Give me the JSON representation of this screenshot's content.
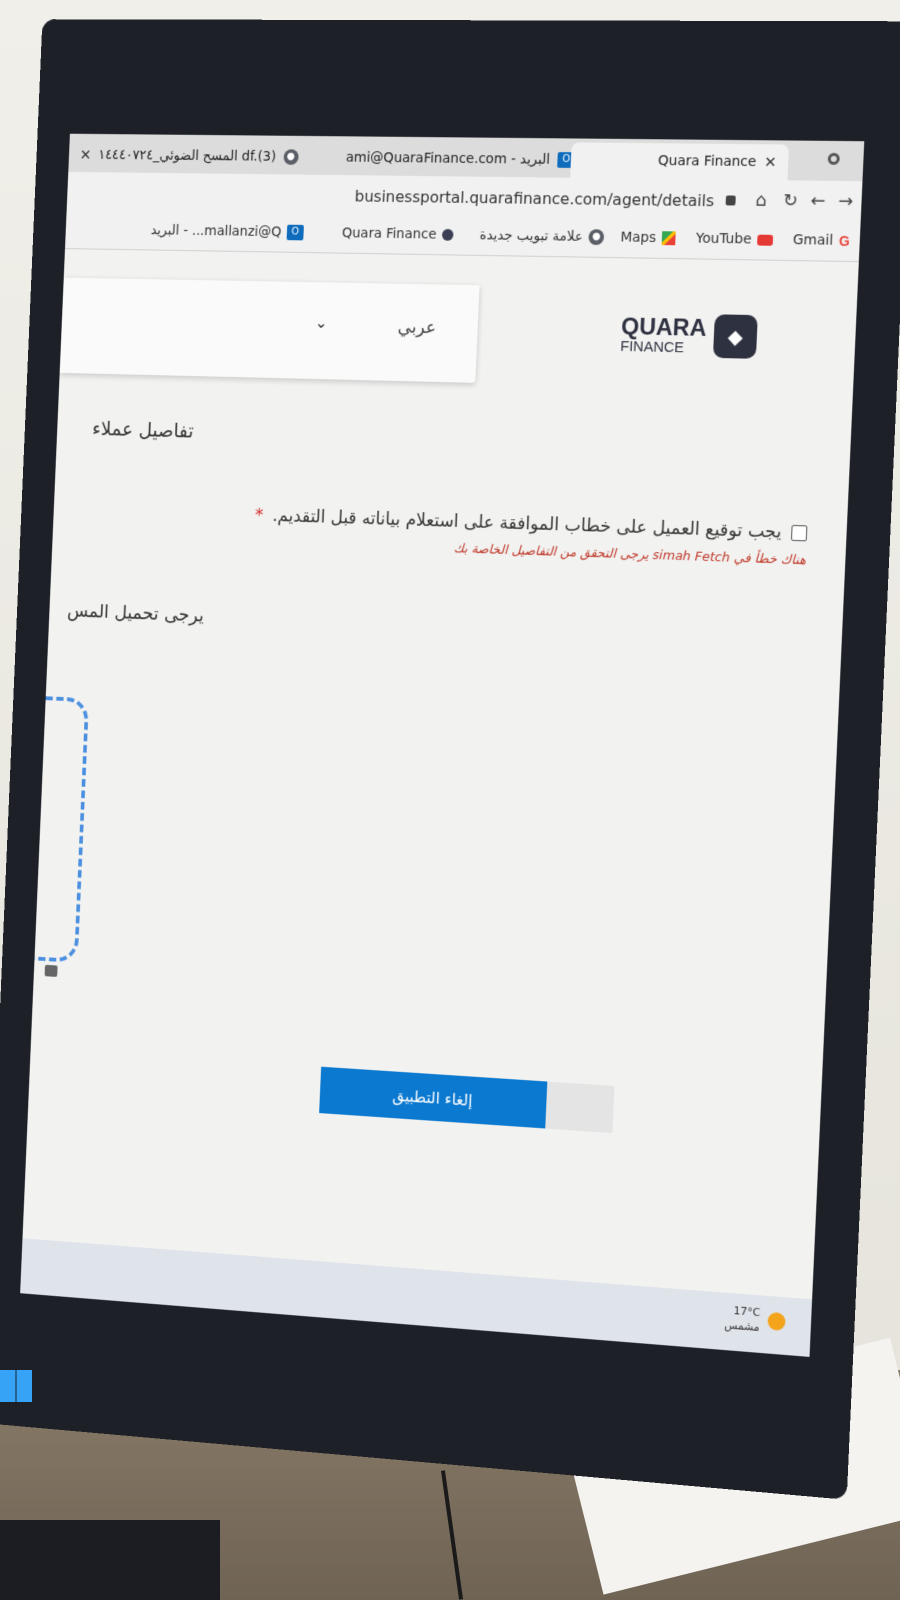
{
  "browser": {
    "tabs": [
      {
        "title": "df.(3) المسح الضوئي_١٤٤٤٠٧٢٤",
        "icon": "globe-icon"
      },
      {
        "title": "البريد - ami@QuaraFinance.com",
        "icon": "outlook-icon"
      },
      {
        "title": "Quara Finance",
        "icon": "quara-icon",
        "active": true
      }
    ],
    "url": "businessportal.quarafinance.com/agent/details",
    "bookmarks": [
      {
        "label": "Gmail",
        "icon": "gmail-icon"
      },
      {
        "label": "YouTube",
        "icon": "youtube-icon"
      },
      {
        "label": "Maps",
        "icon": "maps-icon"
      },
      {
        "label": "علامة تبويب جديدة",
        "icon": "globe-icon"
      },
      {
        "label": "Quara Finance",
        "icon": "quara-icon"
      },
      {
        "label": "البريد - ...mallanzi@Q",
        "icon": "outlook-icon"
      }
    ]
  },
  "header": {
    "language_label": "عربي",
    "logo_name": "QUARA",
    "logo_sub": "FINANCE"
  },
  "form": {
    "section_title": "تفاصيل عملاء",
    "consent_text": "يجب توقيع العميل على خطاب الموافقة على استعلام بياناته قبل التقديم.",
    "required_mark": "*",
    "error_text": "هناك خطأ في simah Fetch يرجى التحقق من التفاصيل الخاصة بك",
    "upload_label": "يرجى تحميل المس",
    "cancel_button": "إلغاء التطبيق"
  },
  "taskbar": {
    "temperature": "17°C",
    "weather": "مشمس"
  }
}
